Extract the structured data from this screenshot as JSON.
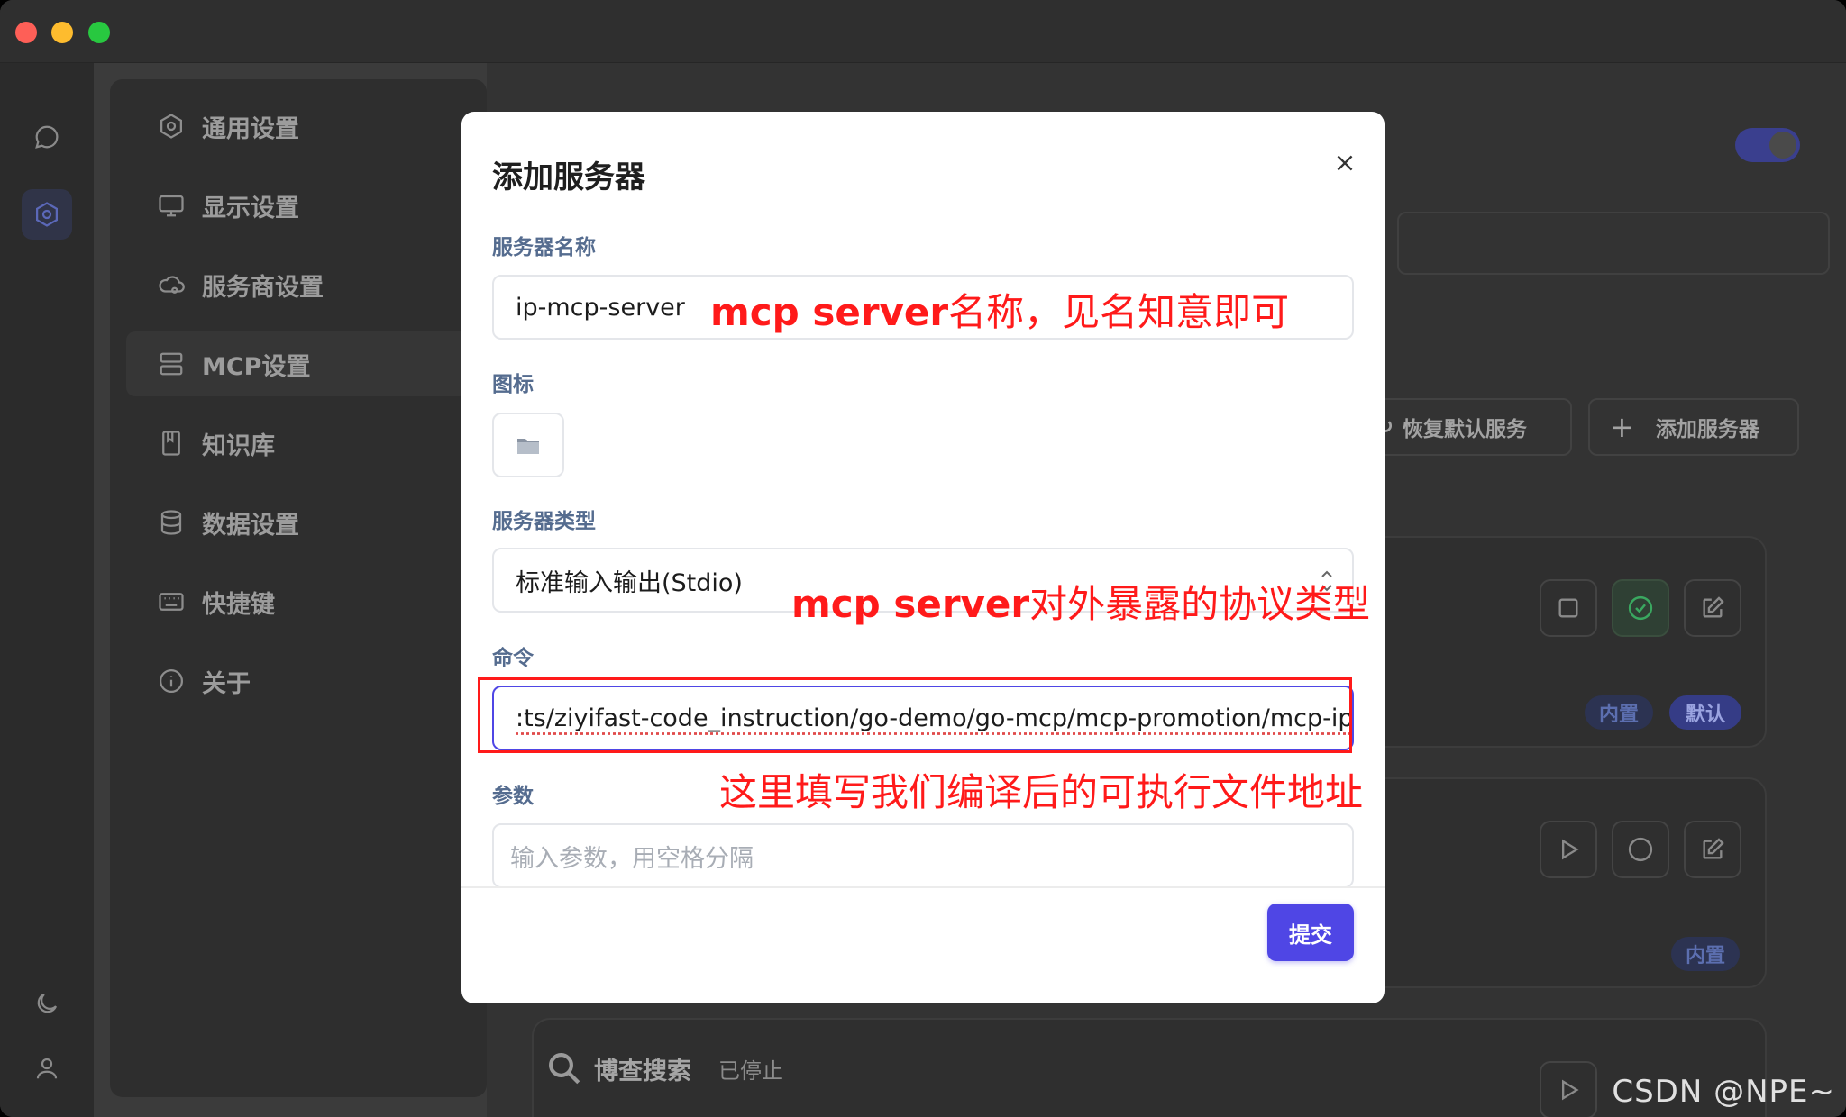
{
  "sidebar": {
    "items": [
      {
        "label": "通用设置",
        "icon": "gear-icon"
      },
      {
        "label": "显示设置",
        "icon": "monitor-icon"
      },
      {
        "label": "服务商设置",
        "icon": "cloud-icon"
      },
      {
        "label": "MCP设置",
        "icon": "server-icon",
        "active": true
      },
      {
        "label": "知识库",
        "icon": "book-icon"
      },
      {
        "label": "数据设置",
        "icon": "database-icon"
      },
      {
        "label": "快捷键",
        "icon": "keyboard-icon"
      },
      {
        "label": "关于",
        "icon": "info-icon"
      }
    ]
  },
  "background": {
    "restore_button": "恢复默认服务",
    "add_button": "添加服务器",
    "badge_builtin": "内置",
    "badge_default": "默认",
    "badge_builtin_2": "内置",
    "service_name": "博查搜索",
    "service_status": "已停止"
  },
  "modal": {
    "title": "添加服务器",
    "name_label": "服务器名称",
    "name_value": "ip-mcp-server",
    "icon_label": "图标",
    "type_label": "服务器类型",
    "type_value": "标准输入输出(Stdio)",
    "command_label": "命令",
    "command_value": ":ts/ziyifast-code_instruction/go-demo/go-mcp/mcp-promotion/mcp-ip",
    "args_label": "参数",
    "args_placeholder": "输入参数，用空格分隔",
    "submit_label": "提交"
  },
  "annotations": {
    "a1_bold": "mcp server",
    "a1_rest": "名称，见名知意即可",
    "a2_bold": "mcp server",
    "a2_rest": "对外暴露的协议类型",
    "a3": "这里填写我们编译后的可执行文件地址"
  },
  "watermark": "CSDN @NPE~",
  "colors": {
    "accent": "#4f46e5",
    "annotation": "#ff1a1a"
  }
}
